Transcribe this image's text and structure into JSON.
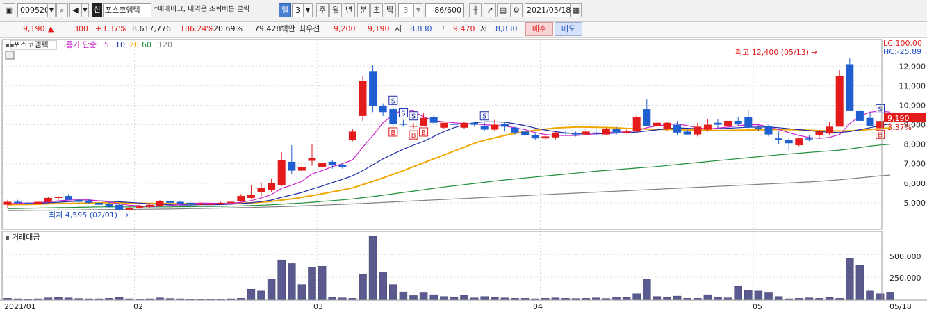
{
  "toolbar": {
    "stock_code": "009520",
    "credit_badge": "신",
    "stock_name": "포스코엠텍",
    "notice": "*매매마크, 내역은 조회버튼 클릭",
    "period_tabs": [
      "일",
      "3",
      "주",
      "월",
      "년",
      "분",
      "초",
      "틱"
    ],
    "minute_value": "3",
    "count": "86/600",
    "date": "2021/05/18"
  },
  "quote": {
    "price": "9,190",
    "change_arrow": "▲",
    "change": "300",
    "change_pct": "+3.37%",
    "volume": "8,617,776",
    "volume_ratio": "186.24%",
    "turnover": "20.69%",
    "amount": "79,428백만",
    "best_label": "최우선",
    "ask": "9,200",
    "bid": "9,190",
    "open_label": "시",
    "open": "8,830",
    "high_label": "고",
    "high": "9,470",
    "low_label": "저",
    "low": "8,830",
    "buy_button": "매수",
    "sell_button": "매도"
  },
  "price_panel": {
    "name_label": "포스코엠텍",
    "ma_label": "종가 단순",
    "ma_periods": [
      "5",
      "10",
      "20",
      "60",
      "120"
    ],
    "ma_colors": [
      "#cc20cc",
      "#1c2aa8",
      "#f0a800",
      "#1f8f3a",
      "#808080"
    ],
    "lc": "LC:100.00",
    "hc": "HC:-25.89",
    "max_annotation": "최고 12,400 (05/13)",
    "min_annotation": "최저 4,595 (02/01)",
    "current_price_tag": "9,190",
    "current_pct_tag": "3.37%"
  },
  "volume_panel": {
    "label": "거래대금",
    "y_ticks": [
      "500,000",
      "250,000"
    ]
  },
  "x_axis": {
    "labels": [
      "2021/01",
      "02",
      "03",
      "04",
      "05",
      "05/18"
    ]
  },
  "chart_data": {
    "type": "candlestick",
    "title": "",
    "y_ticks": [
      12000,
      11000,
      10000,
      9000,
      8000,
      7000,
      6000,
      5000
    ],
    "ylim": [
      4000,
      12900
    ],
    "volume_ylim": [
      0,
      700000
    ],
    "x_markers": [
      "2021/01",
      "02",
      "03",
      "04",
      "05",
      "05/18"
    ],
    "candles": [
      {
        "o": 4900,
        "h": 5150,
        "l": 4700,
        "c": 5050
      },
      {
        "o": 5050,
        "h": 5150,
        "l": 4950,
        "c": 5000
      },
      {
        "o": 5000,
        "h": 5050,
        "l": 4900,
        "c": 4950
      },
      {
        "o": 4950,
        "h": 5100,
        "l": 4900,
        "c": 5050
      },
      {
        "o": 5050,
        "h": 5300,
        "l": 5000,
        "c": 5250
      },
      {
        "o": 5250,
        "h": 5350,
        "l": 5150,
        "c": 5300
      },
      {
        "o": 5350,
        "h": 5450,
        "l": 5200,
        "c": 5150
      },
      {
        "o": 5150,
        "h": 5200,
        "l": 4950,
        "c": 5050
      },
      {
        "o": 5100,
        "h": 5200,
        "l": 4950,
        "c": 5000
      },
      {
        "o": 5000,
        "h": 5050,
        "l": 4850,
        "c": 4900
      },
      {
        "o": 4950,
        "h": 5050,
        "l": 4750,
        "c": 4800
      },
      {
        "o": 4900,
        "h": 4950,
        "l": 4595,
        "c": 4650
      },
      {
        "o": 4650,
        "h": 4800,
        "l": 4600,
        "c": 4750
      },
      {
        "o": 4750,
        "h": 4900,
        "l": 4700,
        "c": 4850
      },
      {
        "o": 4800,
        "h": 4950,
        "l": 4750,
        "c": 4900
      },
      {
        "o": 4850,
        "h": 5150,
        "l": 4800,
        "c": 5100
      },
      {
        "o": 5100,
        "h": 5150,
        "l": 4950,
        "c": 5000
      },
      {
        "o": 5050,
        "h": 5100,
        "l": 4950,
        "c": 4950
      },
      {
        "o": 5000,
        "h": 5050,
        "l": 4900,
        "c": 4950
      },
      {
        "o": 4950,
        "h": 5000,
        "l": 4900,
        "c": 4950
      },
      {
        "o": 4950,
        "h": 5000,
        "l": 4900,
        "c": 4950
      },
      {
        "o": 4950,
        "h": 5050,
        "l": 4900,
        "c": 5000
      },
      {
        "o": 5000,
        "h": 5100,
        "l": 4950,
        "c": 5050
      },
      {
        "o": 5100,
        "h": 5450,
        "l": 5050,
        "c": 5350
      },
      {
        "o": 5250,
        "h": 5900,
        "l": 5200,
        "c": 5400
      },
      {
        "o": 5550,
        "h": 6050,
        "l": 5350,
        "c": 5750
      },
      {
        "o": 5650,
        "h": 6250,
        "l": 5550,
        "c": 6000
      },
      {
        "o": 5900,
        "h": 7600,
        "l": 5850,
        "c": 7200
      },
      {
        "o": 7100,
        "h": 7950,
        "l": 6450,
        "c": 6650
      },
      {
        "o": 6650,
        "h": 7000,
        "l": 6500,
        "c": 6850
      },
      {
        "o": 7150,
        "h": 8000,
        "l": 6900,
        "c": 7300
      },
      {
        "o": 6850,
        "h": 7300,
        "l": 6700,
        "c": 7050
      },
      {
        "o": 7100,
        "h": 7200,
        "l": 6750,
        "c": 6950
      },
      {
        "o": 6950,
        "h": 7050,
        "l": 6750,
        "c": 6850
      },
      {
        "o": 8200,
        "h": 8800,
        "l": 8150,
        "c": 8650
      },
      {
        "o": 9450,
        "h": 11500,
        "l": 9200,
        "c": 11250
      },
      {
        "o": 11750,
        "h": 12050,
        "l": 9650,
        "c": 9950
      },
      {
        "o": 9950,
        "h": 10100,
        "l": 9450,
        "c": 9650
      },
      {
        "o": 9800,
        "h": 9900,
        "l": 8950,
        "c": 9050
      },
      {
        "o": 9050,
        "h": 9250,
        "l": 8900,
        "c": 9000
      },
      {
        "o": 8950,
        "h": 9100,
        "l": 8800,
        "c": 8950
      },
      {
        "o": 8950,
        "h": 9600,
        "l": 8950,
        "c": 9350
      },
      {
        "o": 9400,
        "h": 9500,
        "l": 9050,
        "c": 9100
      },
      {
        "o": 8850,
        "h": 9100,
        "l": 8800,
        "c": 9100
      },
      {
        "o": 9050,
        "h": 9150,
        "l": 8950,
        "c": 9000
      },
      {
        "o": 8850,
        "h": 9150,
        "l": 8800,
        "c": 9100
      },
      {
        "o": 9100,
        "h": 9150,
        "l": 8900,
        "c": 9000
      },
      {
        "o": 8950,
        "h": 9100,
        "l": 8700,
        "c": 8750
      },
      {
        "o": 8750,
        "h": 9250,
        "l": 8700,
        "c": 9000
      },
      {
        "o": 9050,
        "h": 9100,
        "l": 8650,
        "c": 8900
      },
      {
        "o": 8850,
        "h": 8900,
        "l": 8500,
        "c": 8600
      },
      {
        "o": 8650,
        "h": 8700,
        "l": 8300,
        "c": 8450
      },
      {
        "o": 8450,
        "h": 8550,
        "l": 8200,
        "c": 8300
      },
      {
        "o": 8300,
        "h": 8450,
        "l": 8200,
        "c": 8400
      },
      {
        "o": 8350,
        "h": 8650,
        "l": 8250,
        "c": 8600
      },
      {
        "o": 8600,
        "h": 8700,
        "l": 8500,
        "c": 8550
      },
      {
        "o": 8550,
        "h": 8650,
        "l": 8400,
        "c": 8500
      },
      {
        "o": 8500,
        "h": 8750,
        "l": 8450,
        "c": 8650
      },
      {
        "o": 8600,
        "h": 8800,
        "l": 8500,
        "c": 8550
      },
      {
        "o": 8500,
        "h": 8850,
        "l": 8450,
        "c": 8800
      },
      {
        "o": 8800,
        "h": 8900,
        "l": 8500,
        "c": 8600
      },
      {
        "o": 8600,
        "h": 8750,
        "l": 8550,
        "c": 8650
      },
      {
        "o": 8650,
        "h": 9500,
        "l": 8600,
        "c": 9400
      },
      {
        "o": 9800,
        "h": 10300,
        "l": 9050,
        "c": 8950
      },
      {
        "o": 8950,
        "h": 9250,
        "l": 8850,
        "c": 9100
      },
      {
        "o": 8800,
        "h": 9150,
        "l": 8700,
        "c": 9100
      },
      {
        "o": 9000,
        "h": 9200,
        "l": 8450,
        "c": 8600
      },
      {
        "o": 8650,
        "h": 8750,
        "l": 8450,
        "c": 8500
      },
      {
        "o": 8500,
        "h": 9100,
        "l": 8400,
        "c": 8900
      },
      {
        "o": 8750,
        "h": 9300,
        "l": 8650,
        "c": 9000
      },
      {
        "o": 9100,
        "h": 9300,
        "l": 8800,
        "c": 9000
      },
      {
        "o": 8950,
        "h": 9200,
        "l": 8850,
        "c": 9200
      },
      {
        "o": 9200,
        "h": 9400,
        "l": 8950,
        "c": 9050
      },
      {
        "o": 9400,
        "h": 9750,
        "l": 8750,
        "c": 8850
      },
      {
        "o": 8850,
        "h": 9000,
        "l": 8700,
        "c": 8800
      },
      {
        "o": 8950,
        "h": 9000,
        "l": 8400,
        "c": 8500
      },
      {
        "o": 8300,
        "h": 8650,
        "l": 8000,
        "c": 8200
      },
      {
        "o": 8200,
        "h": 8350,
        "l": 7700,
        "c": 8050
      },
      {
        "o": 7950,
        "h": 8350,
        "l": 7900,
        "c": 8300
      },
      {
        "o": 8300,
        "h": 8450,
        "l": 8150,
        "c": 8250
      },
      {
        "o": 8450,
        "h": 8750,
        "l": 8350,
        "c": 8650
      },
      {
        "o": 8550,
        "h": 9150,
        "l": 8450,
        "c": 8900
      },
      {
        "o": 8900,
        "h": 11800,
        "l": 8900,
        "c": 11500
      },
      {
        "o": 12100,
        "h": 12400,
        "l": 9700,
        "c": 9700
      },
      {
        "o": 9700,
        "h": 9950,
        "l": 9150,
        "c": 9200
      },
      {
        "o": 9350,
        "h": 9650,
        "l": 8950,
        "c": 8950
      },
      {
        "o": 8830,
        "h": 9470,
        "l": 8830,
        "c": 9190
      }
    ],
    "ma5": [
      4950,
      4980,
      4990,
      5000,
      5050,
      5100,
      5140,
      5150,
      5150,
      5100,
      5040,
      4950,
      4880,
      4850,
      4800,
      4830,
      4860,
      4900,
      4960,
      4990,
      4980,
      4970,
      4970,
      5030,
      5110,
      5250,
      5420,
      5740,
      5900,
      6100,
      6480,
      6650,
      6850,
      7000,
      7200,
      7850,
      8450,
      9100,
      9500,
      9800,
      9700,
      9400,
      9200,
      9150,
      9100,
      9050,
      9050,
      9000,
      8970,
      8930,
      8850,
      8750,
      8600,
      8500,
      8450,
      8450,
      8450,
      8480,
      8550,
      8600,
      8630,
      8630,
      8700,
      8850,
      8950,
      9000,
      9050,
      8950,
      8850,
      8780,
      8830,
      8880,
      8950,
      9000,
      9000,
      8900,
      8750,
      8600,
      8450,
      8350,
      8300,
      8350,
      8500,
      9050,
      9450,
      9650,
      9700,
      9650
    ],
    "ma10": [
      4950,
      4960,
      4970,
      4980,
      5000,
      5030,
      5060,
      5080,
      5100,
      5100,
      5080,
      5050,
      5020,
      4990,
      4950,
      4920,
      4900,
      4890,
      4890,
      4900,
      4900,
      4910,
      4930,
      4960,
      5000,
      5060,
      5140,
      5280,
      5400,
      5530,
      5700,
      5860,
      6040,
      6200,
      6390,
      6650,
      6950,
      7250,
      7500,
      7750,
      7950,
      8150,
      8400,
      8650,
      8850,
      9000,
      9100,
      9150,
      9150,
      9130,
      9050,
      8950,
      8830,
      8730,
      8650,
      8580,
      8540,
      8520,
      8530,
      8550,
      8570,
      8590,
      8620,
      8680,
      8740,
      8790,
      8840,
      8820,
      8800,
      8780,
      8800,
      8820,
      8850,
      8870,
      8880,
      8880,
      8850,
      8800,
      8750,
      8700,
      8650,
      8620,
      8600,
      8650,
      8750,
      8850,
      8950,
      9050
    ],
    "ma20": [
      4900,
      4910,
      4920,
      4930,
      4950,
      4960,
      4970,
      4980,
      4990,
      5000,
      5000,
      5000,
      4990,
      4980,
      4970,
      4960,
      4950,
      4950,
      4950,
      4950,
      4950,
      4950,
      4960,
      4980,
      5000,
      5030,
      5070,
      5140,
      5200,
      5280,
      5370,
      5460,
      5560,
      5660,
      5770,
      5930,
      6100,
      6280,
      6460,
      6650,
      6850,
      7050,
      7250,
      7450,
      7650,
      7850,
      8050,
      8200,
      8330,
      8450,
      8560,
      8650,
      8720,
      8780,
      8830,
      8860,
      8880,
      8880,
      8870,
      8860,
      8840,
      8810,
      8790,
      8780,
      8770,
      8760,
      8750,
      8740,
      8730,
      8720,
      8710,
      8710,
      8720,
      8730,
      8740,
      8750,
      8760,
      8750,
      8740,
      8720,
      8700,
      8690,
      8680,
      8690,
      8720,
      8760,
      8800,
      8840
    ],
    "ma60": [
      4700,
      4710,
      4720,
      4730,
      4740,
      4750,
      4760,
      4770,
      4780,
      4790,
      4790,
      4790,
      4790,
      4790,
      4790,
      4790,
      4790,
      4800,
      4800,
      4810,
      4810,
      4820,
      4830,
      4840,
      4860,
      4880,
      4900,
      4930,
      4960,
      4990,
      5030,
      5070,
      5110,
      5150,
      5200,
      5260,
      5320,
      5390,
      5460,
      5530,
      5600,
      5670,
      5740,
      5810,
      5870,
      5930,
      5990,
      6050,
      6110,
      6170,
      6220,
      6270,
      6320,
      6370,
      6420,
      6470,
      6520,
      6570,
      6620,
      6660,
      6700,
      6740,
      6780,
      6820,
      6860,
      6910,
      6960,
      7010,
      7060,
      7110,
      7160,
      7210,
      7260,
      7310,
      7360,
      7410,
      7460,
      7500,
      7540,
      7580,
      7620,
      7660,
      7700,
      7760,
      7830,
      7900,
      7960,
      8000
    ],
    "ma120": [
      4600,
      4605,
      4610,
      4615,
      4620,
      4625,
      4630,
      4635,
      4640,
      4645,
      4650,
      4655,
      4660,
      4665,
      4670,
      4675,
      4680,
      4690,
      4700,
      4710,
      4720,
      4730,
      4740,
      4750,
      4760,
      4775,
      4790,
      4805,
      4820,
      4840,
      4860,
      4880,
      4900,
      4920,
      4945,
      4970,
      4995,
      5020,
      5045,
      5070,
      5095,
      5120,
      5145,
      5170,
      5195,
      5220,
      5245,
      5270,
      5295,
      5320,
      5345,
      5370,
      5395,
      5420,
      5445,
      5470,
      5495,
      5520,
      5545,
      5570,
      5595,
      5620,
      5645,
      5670,
      5695,
      5720,
      5745,
      5770,
      5795,
      5820,
      5845,
      5870,
      5895,
      5920,
      5945,
      5970,
      5995,
      6020,
      6045,
      6070,
      6100,
      6140,
      6180,
      6230,
      6280,
      6330,
      6380,
      6420
    ],
    "volume": [
      20000,
      15000,
      12000,
      15000,
      25000,
      30000,
      25000,
      18000,
      15000,
      15000,
      20000,
      30000,
      15000,
      12000,
      15000,
      25000,
      18000,
      15000,
      12000,
      10000,
      10000,
      12000,
      15000,
      20000,
      120000,
      100000,
      230000,
      440000,
      400000,
      170000,
      360000,
      370000,
      30000,
      25000,
      20000,
      280000,
      700000,
      310000,
      170000,
      90000,
      50000,
      80000,
      60000,
      40000,
      30000,
      55000,
      25000,
      40000,
      30000,
      25000,
      20000,
      20000,
      15000,
      20000,
      25000,
      20000,
      18000,
      20000,
      25000,
      18000,
      35000,
      30000,
      70000,
      230000,
      40000,
      30000,
      45000,
      20000,
      20000,
      60000,
      35000,
      25000,
      150000,
      110000,
      100000,
      80000,
      40000,
      15000,
      20000,
      25000,
      20000,
      30000,
      20000,
      460000,
      380000,
      100000,
      70000,
      85000
    ],
    "markers": [
      {
        "i": 38,
        "type": "S"
      },
      {
        "i": 38,
        "type": "B"
      },
      {
        "i": 39,
        "type": "S"
      },
      {
        "i": 40,
        "type": "S"
      },
      {
        "i": 40,
        "type": "B"
      },
      {
        "i": 41,
        "type": "B"
      },
      {
        "i": 47,
        "type": "S"
      },
      {
        "i": 86,
        "type": "S"
      },
      {
        "i": 86,
        "type": "B"
      }
    ]
  }
}
